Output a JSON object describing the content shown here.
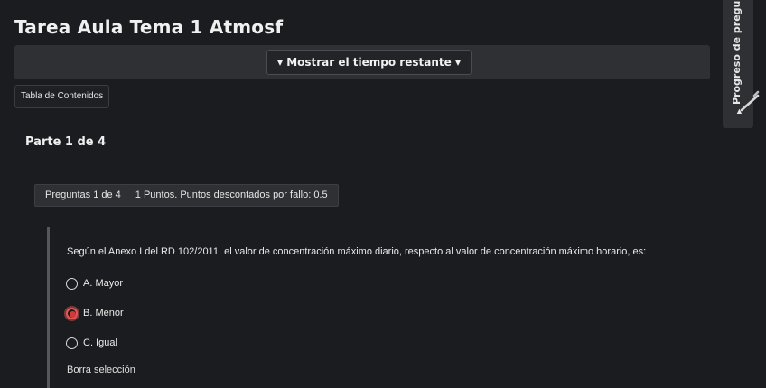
{
  "quiz": {
    "title": "Tarea Aula Tema 1 Atmosf"
  },
  "timer": {
    "toggle_label": "▾ Mostrar el tiempo restante ▾"
  },
  "toc": {
    "button_label": "Tabla de Contenidos"
  },
  "progress_tab": {
    "label": "Progreso de pregun",
    "arrow": "▲"
  },
  "part": {
    "label": "Parte 1 de 4"
  },
  "question_info": {
    "number": "Preguntas 1 de 4",
    "points": "1 Puntos. Puntos descontados por fallo: 0.5"
  },
  "question": {
    "text": "Según el Anexo I del RD 102/2011, el valor de concentración máximo diario, respecto al valor de concentración máximo horario, es:",
    "options": [
      {
        "label": "A. Mayor",
        "selected": false
      },
      {
        "label": "B. Menor",
        "selected": true
      },
      {
        "label": "C. Igual",
        "selected": false
      }
    ],
    "clear_label": "Borra selección"
  },
  "colors": {
    "background": "#1b1c1f",
    "panel": "#2e3034",
    "selected_radio": "#d23a3a"
  }
}
